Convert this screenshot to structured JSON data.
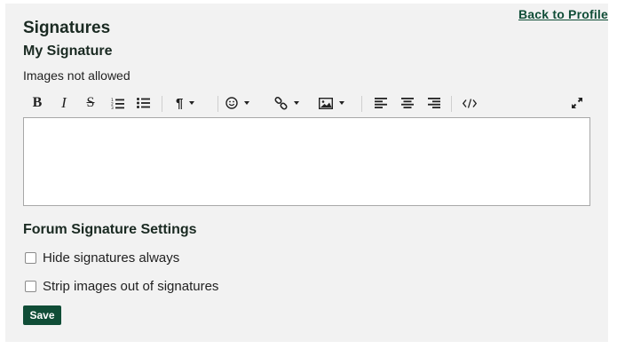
{
  "header": {
    "back_link": "Back to Profile",
    "title": "Signatures"
  },
  "signature": {
    "heading": "My Signature",
    "note": "Images not allowed",
    "editor_value": ""
  },
  "toolbar": {
    "buttons": [
      "bold",
      "italic",
      "strikethrough",
      "ordered-list",
      "unordered-list",
      "paragraph",
      "emoji",
      "link",
      "image",
      "align-left",
      "align-center",
      "align-right",
      "source-code",
      "fullscreen"
    ]
  },
  "settings": {
    "heading": "Forum Signature Settings",
    "hide_label": "Hide signatures always",
    "strip_label": "Strip images out of signatures",
    "save_label": "Save"
  },
  "colors": {
    "accent": "#104d37",
    "panel_bg": "#f2f2f2"
  }
}
